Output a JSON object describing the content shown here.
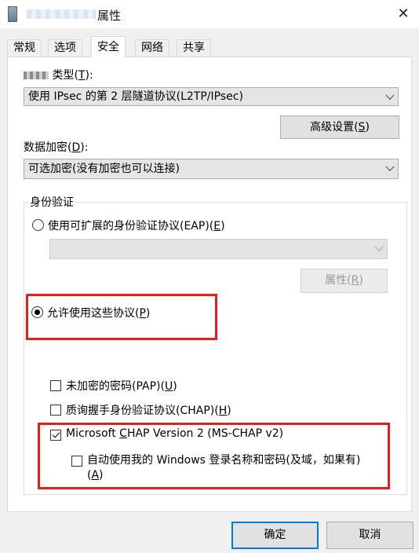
{
  "window": {
    "title": "属性",
    "close": "✕"
  },
  "tabs": [
    "常规",
    "选项",
    "安全",
    "网络",
    "共享"
  ],
  "active_tab": "安全",
  "vpn_type": {
    "label_prefix": "类型(",
    "label_key": "T",
    "label_suffix": "):",
    "value": "使用 IPsec 的第 2 层隧道协议(L2TP/IPsec)"
  },
  "advanced_button": {
    "label": "高级设置(",
    "key": "S",
    "suffix": ")"
  },
  "encryption": {
    "label_prefix": "数据加密(",
    "label_key": "D",
    "label_suffix": "):",
    "value": "可选加密(没有加密也可以连接)"
  },
  "auth": {
    "legend": "身份验证",
    "eap_option": {
      "label": "使用可扩展的身份验证协议(EAP)(",
      "key": "E",
      "suffix": ")",
      "checked": false
    },
    "eap_combo_value": "",
    "properties_button": {
      "label": "属性(",
      "key": "R",
      "suffix": ")"
    },
    "allow_option": {
      "label": "允许使用这些协议(",
      "key": "P",
      "suffix": ")",
      "checked": true
    },
    "pap": {
      "label": "未加密的密码(PAP)(",
      "key": "U",
      "suffix": ")",
      "checked": false
    },
    "chap": {
      "label": "质询握手身份验证协议(CHAP)(",
      "key": "H",
      "suffix": ")",
      "checked": false
    },
    "mschap": {
      "label_pre": "Microsoft ",
      "key": "C",
      "label_post": "HAP Version 2 (MS-CHAP v2)",
      "checked": true
    },
    "auto_logon": {
      "label_line1": "自动使用我的 Windows 登录名称和密码(及域，如果有)",
      "line2_pre": "(",
      "key": "A",
      "line2_post": ")",
      "checked": false
    }
  },
  "footer": {
    "ok": "确定",
    "cancel": "取消"
  },
  "colors": {
    "highlight_box": "#e02020",
    "default_button_border": "#0078d7"
  }
}
